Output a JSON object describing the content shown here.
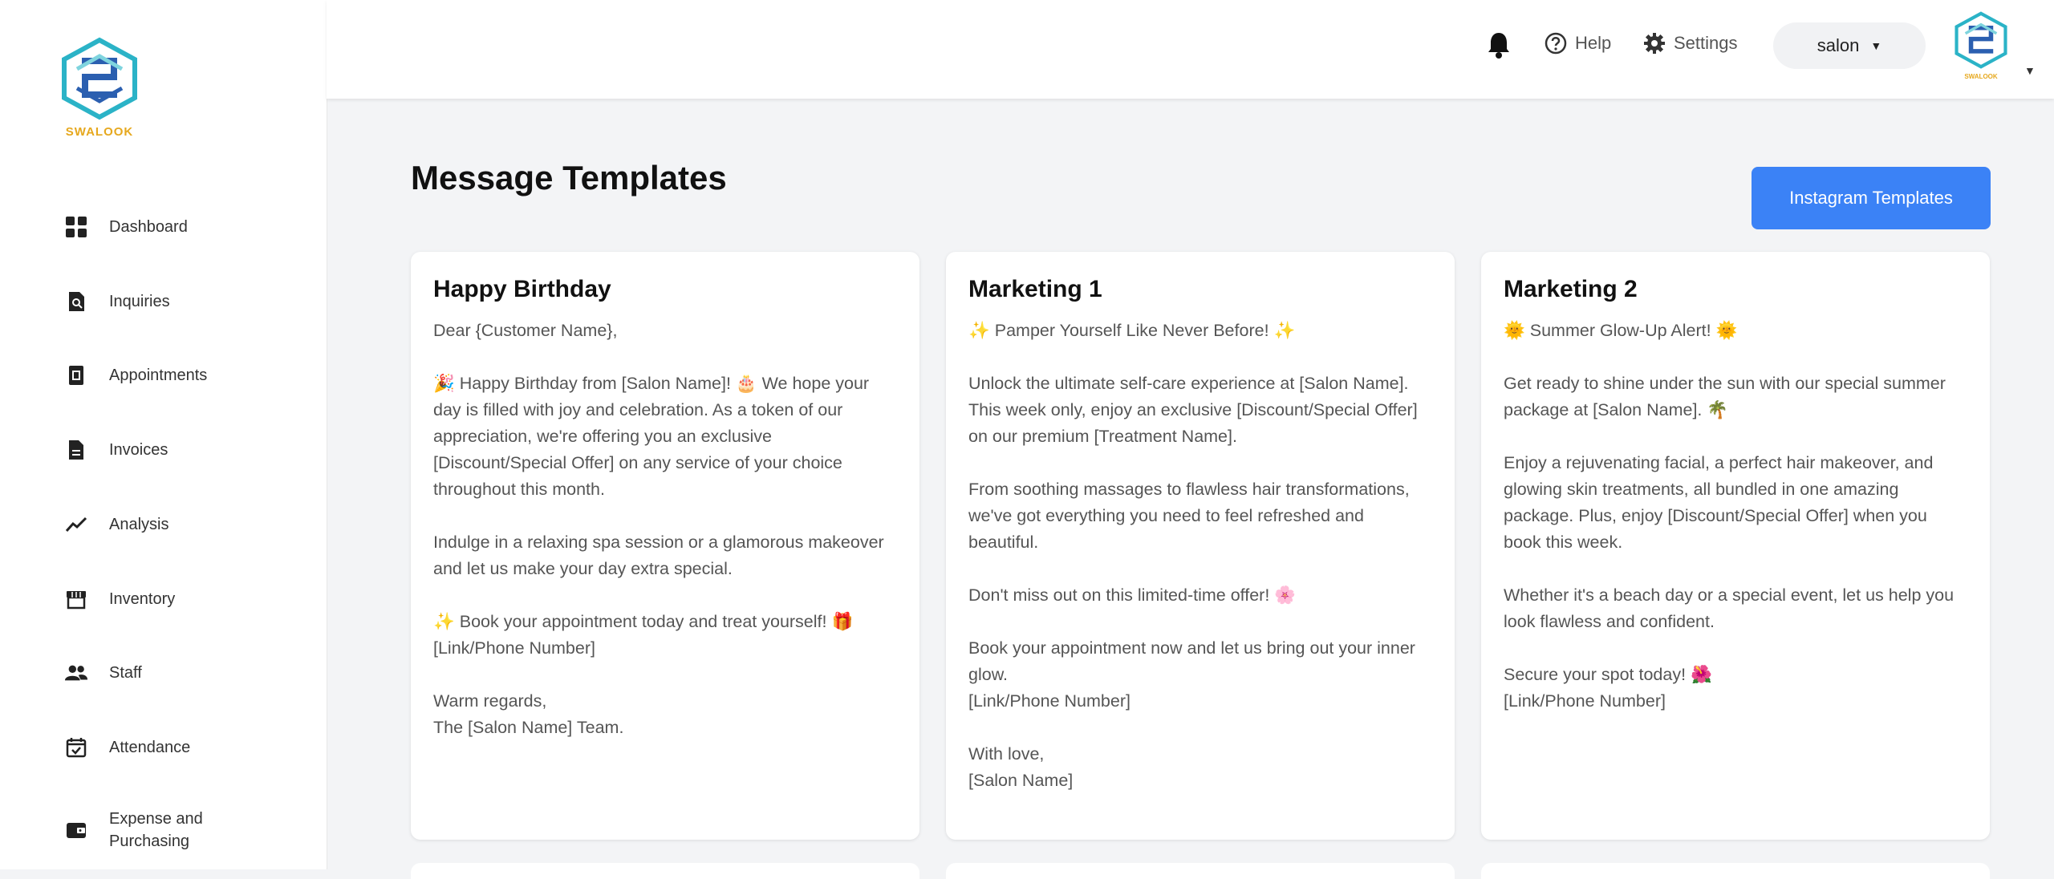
{
  "brand": {
    "name": "SWALOOK"
  },
  "sidebar": {
    "items": [
      {
        "label": "Dashboard",
        "icon": "dashboard-icon"
      },
      {
        "label": "Inquiries",
        "icon": "inquiries-icon"
      },
      {
        "label": "Appointments",
        "icon": "appointments-icon"
      },
      {
        "label": "Invoices",
        "icon": "invoices-icon"
      },
      {
        "label": "Analysis",
        "icon": "analysis-icon"
      },
      {
        "label": "Inventory",
        "icon": "inventory-icon"
      },
      {
        "label": "Staff",
        "icon": "staff-icon"
      },
      {
        "label": "Attendance",
        "icon": "attendance-icon"
      },
      {
        "label": "Expense and\nPurchasing",
        "icon": "expense-icon"
      }
    ]
  },
  "header": {
    "help_label": "Help",
    "settings_label": "Settings",
    "salon_label": "salon",
    "logo_caption": "SWALOOK"
  },
  "main": {
    "title": "Message Templates",
    "instagram_button": "Instagram Templates",
    "templates": [
      {
        "title": "Happy Birthday",
        "paragraphs": [
          "Dear {Customer Name},",
          "🎉 Happy Birthday from [Salon Name]! 🎂 We hope your day is filled with joy and celebration. As a token of our appreciation, we're offering you an exclusive [Discount/Special Offer] on any service of your choice throughout this month.",
          "Indulge in a relaxing spa session or a glamorous makeover and let us make your day extra special.",
          "✨ Book your appointment today and treat yourself! 🎁\n[Link/Phone Number]",
          "Warm regards,\nThe [Salon Name] Team."
        ]
      },
      {
        "title": "Marketing 1",
        "paragraphs": [
          "✨ Pamper Yourself Like Never Before! ✨",
          "Unlock the ultimate self-care experience at [Salon Name]. This week only, enjoy an exclusive [Discount/Special Offer] on our premium [Treatment Name].",
          "From soothing massages to flawless hair transformations, we've got everything you need to feel refreshed and beautiful.",
          "Don't miss out on this limited-time offer! 🌸",
          "Book your appointment now and let us bring out your inner glow.\n[Link/Phone Number]",
          "With love,\n[Salon Name]"
        ]
      },
      {
        "title": "Marketing 2",
        "paragraphs": [
          "🌞 Summer Glow-Up Alert! 🌞",
          "Get ready to shine under the sun with our special summer package at [Salon Name]. 🌴",
          "Enjoy a rejuvenating facial, a perfect hair makeover, and glowing skin treatments, all bundled in one amazing package. Plus, enjoy [Discount/Special Offer] when you book this week.",
          "Whether it's a beach day or a special event, let us help you look flawless and confident.",
          "Secure your spot today! 🌺\n[Link/Phone Number]"
        ]
      }
    ]
  },
  "colors": {
    "accent": "#3b82f6",
    "brand_gold": "#e6a81e",
    "brand_teal": "#2bb3c7",
    "brand_blue": "#2b5fb0"
  }
}
